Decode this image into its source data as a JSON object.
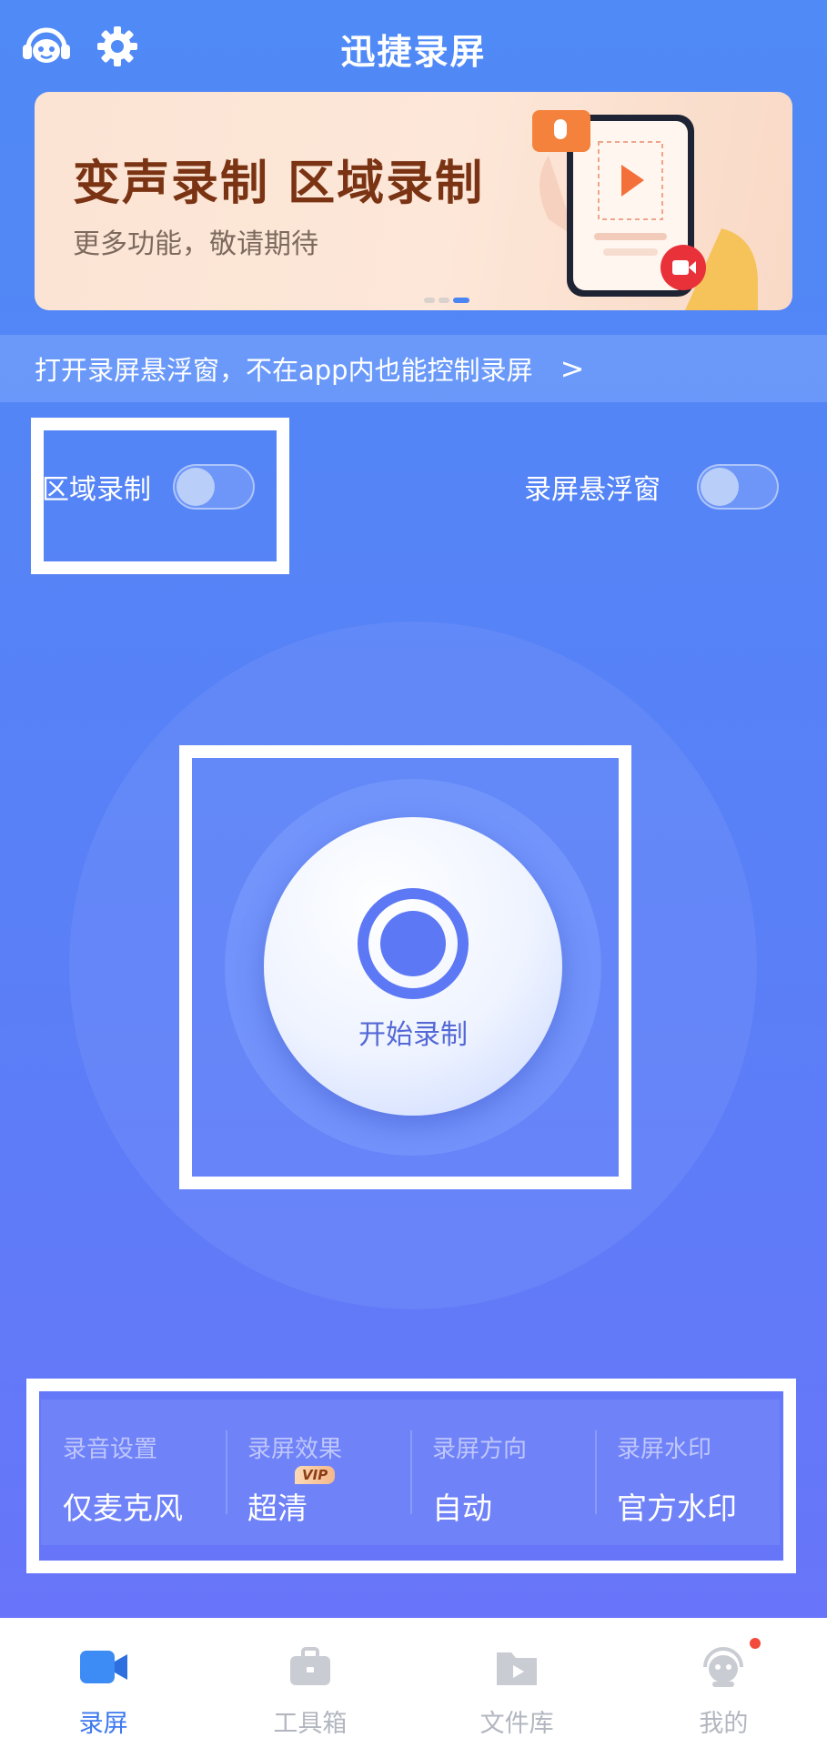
{
  "header": {
    "title": "迅捷录屏",
    "left_icons": [
      "support-robot-icon",
      "gear-icon"
    ]
  },
  "banner": {
    "headline": "变声录制 区域录制",
    "subline": "更多功能，敬请期待",
    "illustration": "phone-recording-illustration",
    "dots": 3,
    "active_dot": 3
  },
  "notice": {
    "text": "打开录屏悬浮窗，不在app内也能控制录屏",
    "chevron": ">"
  },
  "toggles": {
    "region": {
      "label": "区域录制",
      "on": false
    },
    "floating": {
      "label": "录屏悬浮窗",
      "on": false
    }
  },
  "record": {
    "label": "开始录制"
  },
  "settings": [
    {
      "caption": "录音设置",
      "value": "仅麦克风"
    },
    {
      "caption": "录屏效果",
      "value": "超清",
      "badge": "VIP"
    },
    {
      "caption": "录屏方向",
      "value": "自动"
    },
    {
      "caption": "录屏水印",
      "value": "官方水印"
    }
  ],
  "tabs": [
    {
      "label": "录屏",
      "icon": "video-camera-icon",
      "active": true
    },
    {
      "label": "工具箱",
      "icon": "toolbox-icon",
      "active": false
    },
    {
      "label": "文件库",
      "icon": "folder-play-icon",
      "active": false
    },
    {
      "label": "我的",
      "icon": "profile-avatar-icon",
      "active": false,
      "notification_dot": true
    }
  ],
  "colors": {
    "background_top": "#4f8af6",
    "background_bottom": "#6b73fa",
    "accent": "#3d78ef",
    "banner_text": "#7a3313"
  }
}
